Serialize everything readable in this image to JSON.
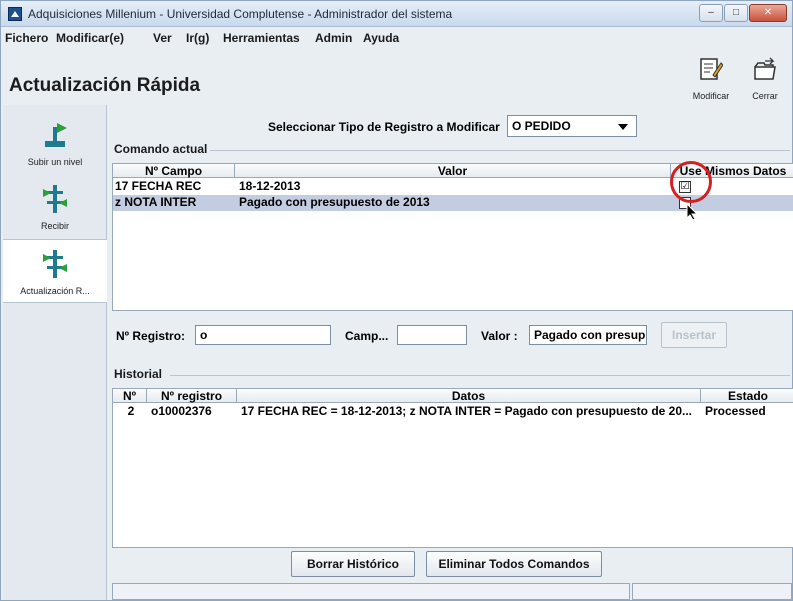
{
  "window": {
    "title": "Adquisiciones Millenium - Universidad Complutense - Administrador del sistema"
  },
  "menu": [
    "Fichero",
    "Modificar(e)",
    "Ver",
    "Ir(g)",
    "Herramientas",
    "Admin",
    "Ayuda"
  ],
  "page_title": "Actualización Rápida",
  "toolbar": {
    "modify_label": "Modificar",
    "close_label": "Cerrar"
  },
  "sidebar": {
    "items": [
      {
        "label": "Subir un nivel",
        "icon": "up-level-icon"
      },
      {
        "label": "Recibir",
        "icon": "receive-icon"
      },
      {
        "label": "Actualización R...",
        "icon": "quick-update-icon"
      }
    ]
  },
  "selector": {
    "label": "Seleccionar Tipo de Registro a Modificar",
    "value": "O PEDIDO"
  },
  "current_command": {
    "title": "Comando actual",
    "columns": [
      "Nº Campo",
      "Valor",
      "Use Mismos Datos"
    ],
    "rows": [
      {
        "field": "17 FECHA REC",
        "value": "18-12-2013",
        "checked": "☑"
      },
      {
        "field": "z NOTA INTER",
        "value": "Pagado con presupuesto de 2013",
        "checked": ""
      }
    ]
  },
  "filter": {
    "record_label": "Nº Registro:",
    "record_value": "o",
    "field_label": "Camp...",
    "field_value": "",
    "value_label": "Valor :",
    "value_value": "Pagado con presup",
    "insert_button": "Insertar"
  },
  "history": {
    "title": "Historial",
    "columns": [
      "Nº",
      "Nº registro",
      "Datos",
      "Estado"
    ],
    "rows": [
      {
        "num": "2",
        "record": "o10002376",
        "data": "17 FECHA REC = 18-12-2013;  z NOTA INTER = Pagado con presupuesto de 20...",
        "status": "Processed"
      }
    ]
  },
  "buttons": {
    "clear_history": "Borrar Histórico",
    "delete_commands": "Eliminar Todos Comandos"
  },
  "colors": {
    "selection": "#c2cde2",
    "highlight_circle": "#d42020"
  }
}
